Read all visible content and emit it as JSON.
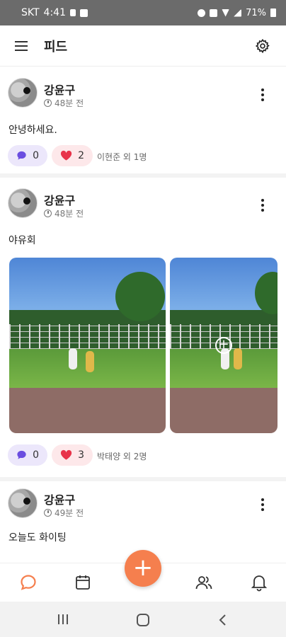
{
  "status_bar": {
    "carrier": "SKT",
    "time": "4:41",
    "battery": "71%"
  },
  "header": {
    "title": "피드",
    "menu_icon": "hamburger-menu-icon",
    "settings_icon": "gear-icon"
  },
  "posts": [
    {
      "author": "강윤구",
      "time": "48분 전",
      "content": "안녕하세요.",
      "comments": "0",
      "likes": "2",
      "likers": "이현준 외 1명",
      "photos": []
    },
    {
      "author": "강윤구",
      "time": "48분 전",
      "content": "야유회",
      "comments": "0",
      "likes": "3",
      "likers": "박태양 외 2명",
      "photos": [
        "photo-kids-field",
        "photo-kids-field-more"
      ]
    },
    {
      "author": "강윤구",
      "time": "49분 전",
      "content": "오늘도 화이팅",
      "comments": "",
      "likes": "",
      "likers": "",
      "photos": []
    }
  ],
  "colors": {
    "accent": "#f57f4e",
    "comment_chip": "#ece7fb",
    "comment_icon": "#6a4de0",
    "like_chip": "#fde8ea",
    "like_icon": "#e8334a"
  },
  "bottom_nav": {
    "items": [
      "chat-bubble-icon",
      "calendar-icon",
      "add-button",
      "people-icon",
      "bell-icon"
    ],
    "active": "chat-bubble-icon"
  },
  "system_nav": [
    "recent-apps-icon",
    "home-icon",
    "back-icon"
  ]
}
